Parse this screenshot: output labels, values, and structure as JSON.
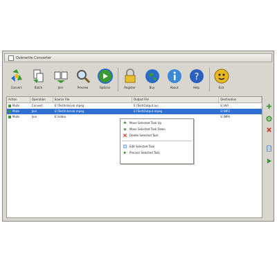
{
  "window": {
    "title": "Overwrite Converter"
  },
  "toolbar": {
    "buttons": [
      {
        "label": "Convert",
        "icon": "recycle-convert-icon"
      },
      {
        "label": "Batch",
        "icon": "batch-convert-icon"
      },
      {
        "label": "Join",
        "icon": "join-files-icon"
      },
      {
        "label": "Preview",
        "icon": "magnifier-preview-icon"
      },
      {
        "label": "Options",
        "icon": "options-globe-icon"
      },
      {
        "label": "Register",
        "icon": "padlock-register-icon"
      },
      {
        "label": "Buy",
        "icon": "globe-buy-icon"
      },
      {
        "label": "About",
        "icon": "info-about-icon"
      },
      {
        "label": "Help",
        "icon": "help-question-icon"
      },
      {
        "label": "Exit",
        "icon": "exit-face-icon"
      }
    ]
  },
  "table": {
    "columns": [
      "Action",
      "Operation",
      "Source File",
      "Output File",
      "Destination"
    ],
    "rows": [
      {
        "action": "Mute",
        "operation": "Convert",
        "source": "E:\\Test\\Interval.mpeg",
        "output": "E:\\Test\\Output.avi",
        "destination": "E:\\AVI",
        "selected": false
      },
      {
        "action": "Mute",
        "operation": "Join",
        "source": "E:\\Test\\Interval.mpeg",
        "output": "E:\\Test\\Output.mpeg",
        "destination": "E:\\MP3",
        "selected": true
      },
      {
        "action": "Mute",
        "operation": "Join",
        "source": "E:\\Video",
        "output": "",
        "destination": "E:\\MP4",
        "selected": false
      }
    ]
  },
  "context_menu": {
    "items": [
      {
        "label": "Move Selected Task Up",
        "icon": "arrow-up-icon"
      },
      {
        "label": "Move Selected Task Down",
        "icon": "arrow-down-icon"
      },
      {
        "label": "Delete Selected Task",
        "icon": "delete-x-icon"
      },
      {
        "label": "Edit Selected Task",
        "icon": "edit-task-icon"
      },
      {
        "label": "Process Selected Task",
        "icon": "play-process-icon"
      }
    ]
  },
  "side_buttons": [
    {
      "icon": "add-plus-icon"
    },
    {
      "icon": "settings-icon"
    },
    {
      "icon": "remove-x-icon"
    },
    {
      "icon": "page-icon"
    },
    {
      "icon": "play-icon"
    }
  ],
  "colors": {
    "selection": "#2e6fd1",
    "window_bg": "#d8d6cf",
    "green": "#3b9a2e",
    "red": "#d03a2a",
    "blue": "#2b6cc9"
  }
}
